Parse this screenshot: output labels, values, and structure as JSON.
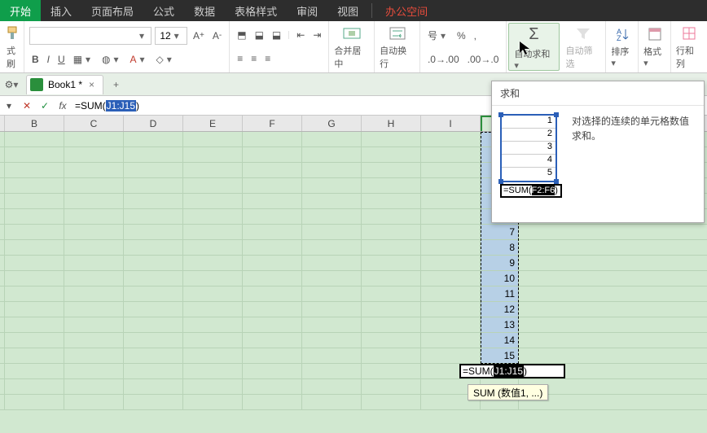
{
  "menu": {
    "tabs": [
      "开始",
      "插入",
      "页面布局",
      "公式",
      "数据",
      "表格样式",
      "审阅",
      "视图"
    ],
    "workspace": "办公空间"
  },
  "ribbon": {
    "format_brush": "式刷",
    "font_name": "",
    "font_size": "12",
    "merge_center": "合并居中",
    "wrap_text": "自动换行",
    "currency": "号",
    "percent": "%",
    "autosum": "自动求和",
    "autofilter": "自动筛选",
    "sort": "排序",
    "format": "格式",
    "rowcol": "行和列"
  },
  "file": {
    "name": "Book1 *"
  },
  "fbar": {
    "prefix": "=SUM(",
    "arg": "J1:J15",
    "suffix": ")"
  },
  "columns": [
    "B",
    "C",
    "D",
    "E",
    "F",
    "G",
    "H",
    "I",
    "J"
  ],
  "jdata": [
    "",
    "",
    "",
    "",
    "",
    "",
    "7",
    "8",
    "9",
    "10",
    "11",
    "12",
    "13",
    "14",
    "15"
  ],
  "editor": {
    "prefix": "=SUM(",
    "arg": "J1:J15",
    "suffix": ")",
    "hint": "SUM (数值1, ...)"
  },
  "tooltip": {
    "title": "求和",
    "desc": "对选择的连续的单元格数值求和。",
    "mini_vals": [
      "1",
      "2",
      "3",
      "4",
      "5"
    ],
    "mini_prefix": "=SUM(",
    "mini_arg": "F2:F6",
    "mini_suffix": ")"
  },
  "chart_data": {
    "type": "table",
    "title": "AutoSum example",
    "columns": [
      "J"
    ],
    "values": [
      7,
      8,
      9,
      10,
      11,
      12,
      13,
      14,
      15
    ],
    "formula": "=SUM(J1:J15)"
  }
}
